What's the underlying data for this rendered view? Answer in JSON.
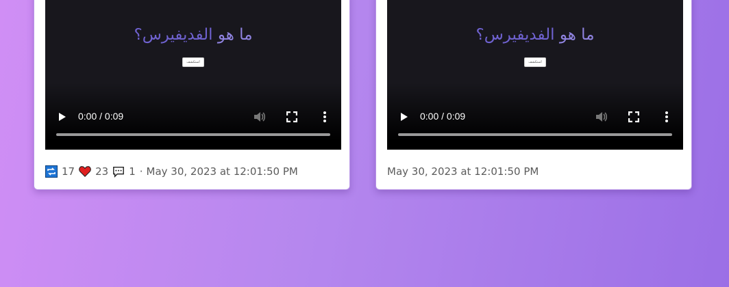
{
  "cards": [
    {
      "video_title_main": "ما هو",
      "video_title_accent": "الفديفيرس؟",
      "badge_text": "استكشف",
      "time_display": "0:00 / 0:09",
      "progress": 0,
      "reposts": "17",
      "likes": "23",
      "comments": "1",
      "separator": "·",
      "timestamp": "May 30, 2023 at 12:01:50 PM"
    },
    {
      "video_title_main": "ما هو",
      "video_title_accent": "الفديفيرس؟",
      "badge_text": "استكشف",
      "time_display": "0:00 / 0:09",
      "progress": 0,
      "timestamp": "May 30, 2023 at 12:01:50 PM"
    }
  ],
  "colors": {
    "background_start": "#d08ef5",
    "background_end": "#9b6fe6",
    "card_border": "#b894e6",
    "video_bg": "#18171d",
    "title_text": "#8f83e0",
    "repost_icon": "#1e74d4",
    "heart_icon": "#e02020"
  },
  "icons": [
    "play-icon",
    "mute-icon",
    "fullscreen-icon",
    "more-options-icon",
    "repost-icon",
    "heart-icon",
    "comment-icon"
  ]
}
